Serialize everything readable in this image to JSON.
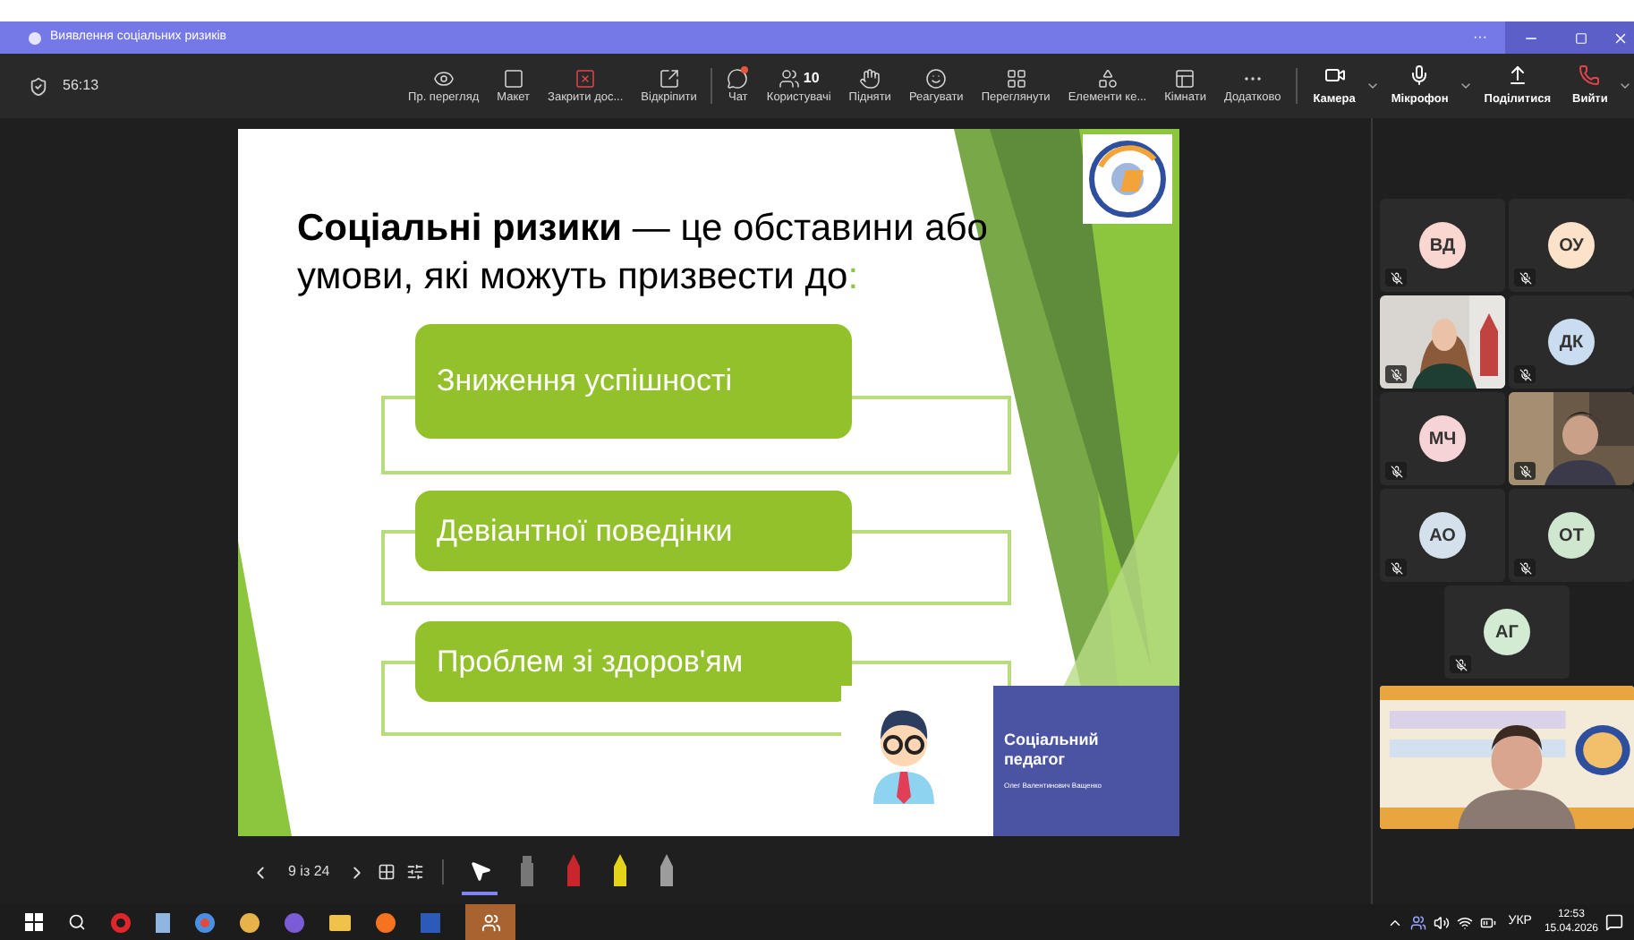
{
  "window": {
    "title": "Виявлення соціальних ризиків",
    "more": "···"
  },
  "toolbar": {
    "timer": "56:13",
    "items": [
      {
        "kind": "eye",
        "label": "Пр. перегляд"
      },
      {
        "kind": "layout",
        "label": "Макет"
      },
      {
        "kind": "stop",
        "label": "Закрити дос..."
      },
      {
        "kind": "popout",
        "label": "Відкріпити"
      },
      {
        "kind": "chat",
        "label": "Чат",
        "badge": true
      },
      {
        "kind": "people",
        "label": "Користувачі",
        "count": "10"
      },
      {
        "kind": "hand",
        "label": "Підняти"
      },
      {
        "kind": "smile",
        "label": "Реагувати"
      },
      {
        "kind": "grid",
        "label": "Переглянути"
      },
      {
        "kind": "apps",
        "label": "Елементи ке..."
      },
      {
        "kind": "rooms",
        "label": "Кімнати"
      },
      {
        "kind": "more",
        "label": "Додатково"
      }
    ],
    "controls": [
      {
        "kind": "camera",
        "label": "Камера"
      },
      {
        "kind": "mic",
        "label": "Мікрофон"
      },
      {
        "kind": "share",
        "label": "Поділитися"
      },
      {
        "kind": "leave",
        "label": "Вийти"
      }
    ]
  },
  "slide": {
    "title": "**Соціальні ризики** — це обставини або умови, які можуть призвести до",
    "title_mark": ":",
    "items": [
      "Зниження успішності",
      "Девіантної поведінки",
      "Проблем зі здоров'ям"
    ],
    "card": {
      "title": "Соціальний педагог",
      "author": "Олег Валентинович Ващенко"
    }
  },
  "slide_nav": {
    "page": "9 із 24",
    "tools": [
      {
        "kind": "pointer",
        "selected": true
      },
      {
        "kind": "eraser",
        "selected": false
      },
      {
        "kind": "pen",
        "selected": false
      },
      {
        "kind": "highlighter",
        "selected": false
      },
      {
        "kind": "marker",
        "selected": false
      }
    ]
  },
  "participants": [
    {
      "kind": "avatar",
      "initials": "ВД",
      "color": "#f9d6cf",
      "muted": true
    },
    {
      "kind": "avatar",
      "initials": "ОУ",
      "color": "#fbe2c8",
      "muted": true
    },
    {
      "kind": "video",
      "muted": true
    },
    {
      "kind": "avatar",
      "initials": "ДК",
      "color": "#c9dcf0",
      "muted": true
    },
    {
      "kind": "avatar",
      "initials": "МЧ",
      "color": "#f6d3d6",
      "muted": true
    },
    {
      "kind": "video",
      "muted": true
    },
    {
      "kind": "avatar",
      "initials": "АО",
      "color": "#d4e1ec",
      "muted": true
    },
    {
      "kind": "avatar",
      "initials": "ОТ",
      "color": "#cfe6cf",
      "muted": true
    },
    {
      "kind": "avatar",
      "initials": "АГ",
      "color": "#d3ead3",
      "muted": true
    }
  ],
  "taskbar": {
    "language": "УКР",
    "time": "12:53",
    "date": "15.04.2026"
  }
}
